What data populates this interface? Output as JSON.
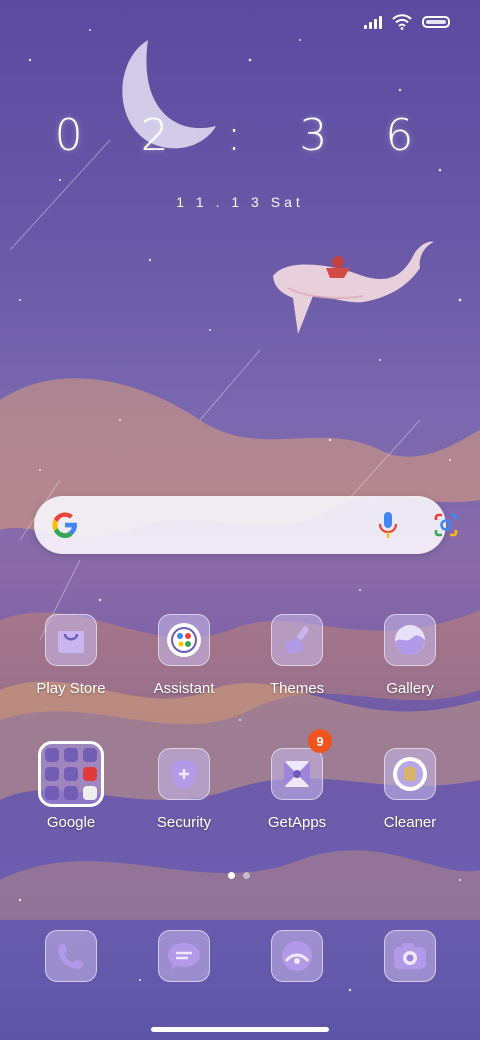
{
  "status_bar": {
    "icons": [
      "signal-icon",
      "wifi-icon",
      "battery-icon"
    ]
  },
  "clock": {
    "time": "0 2 : 3 6",
    "date": "1 1 . 1 3   Sat"
  },
  "search_bar": {
    "icons": [
      "google-g-icon",
      "mic-icon",
      "lens-icon"
    ]
  },
  "apps_row1": [
    {
      "label": "Play Store",
      "icon": "play-store-icon"
    },
    {
      "label": "Assistant",
      "icon": "assistant-icon"
    },
    {
      "label": "Themes",
      "icon": "themes-icon"
    },
    {
      "label": "Gallery",
      "icon": "gallery-icon"
    }
  ],
  "apps_row2": [
    {
      "label": "Google",
      "icon": "folder-icon"
    },
    {
      "label": "Security",
      "icon": "security-icon"
    },
    {
      "label": "GetApps",
      "icon": "getapps-icon",
      "badge": "9"
    },
    {
      "label": "Cleaner",
      "icon": "cleaner-icon"
    }
  ],
  "dock": [
    {
      "icon": "phone-icon"
    },
    {
      "icon": "messages-icon"
    },
    {
      "icon": "browser-icon"
    },
    {
      "icon": "camera-icon"
    }
  ],
  "page_indicator": {
    "count": 2,
    "active": 0
  },
  "colors": {
    "accent": "#b39ae8",
    "badge": "#f0541e",
    "icon_fill": "#c9b6f0"
  }
}
